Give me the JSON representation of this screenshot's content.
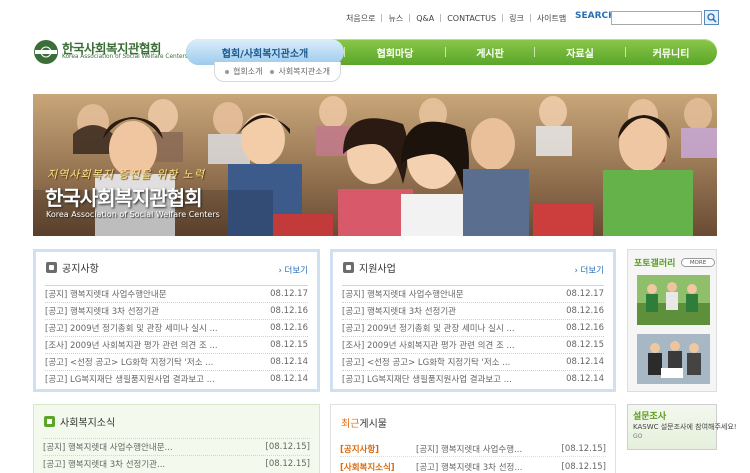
{
  "top_nav": {
    "items": [
      "처음으로",
      "뉴스",
      "Q&A",
      "CONTACTUS",
      "링크",
      "사이트맵"
    ],
    "search_label": "SEARCH",
    "search_value": ""
  },
  "logo": {
    "name_ko": "한국사회복지관협회",
    "name_en": "Korea Association of Social Welfare Centers"
  },
  "main_nav": {
    "tabs": [
      "협회/사회복지관소개",
      "협회마당",
      "게시판",
      "자료실",
      "커뮤니티"
    ],
    "active": "협회/사회복지관소개",
    "sub_items": [
      "협회소개",
      "사회복지관소개"
    ]
  },
  "hero": {
    "slogan": "지역사회복지 증진을 위한 노력",
    "title": "한국사회복지관협회",
    "subtitle": "Korea Association of Social Welfare Centers"
  },
  "notice": {
    "title": "공지사항",
    "more": "› 더보기",
    "rows": [
      {
        "title": "[공지] 행복지렛대 사업수행안내문",
        "date": "08.12.17"
      },
      {
        "title": "[공고] 행복지렛대 3차 선정기관",
        "date": "08.12.16"
      },
      {
        "title": "[공고] 2009년 정기총회 및 관장 세미나 실시 ...",
        "date": "08.12.16"
      },
      {
        "title": "[조사] 2009년 사회복지관 평가 관련 의견 조 ...",
        "date": "08.12.15"
      },
      {
        "title": "[공고] <선정 공고> LG화학 지정기탁 '저소 ...",
        "date": "08.12.14"
      },
      {
        "title": "[공고] LG복지재단 생필품지원사업 결과보고 ...",
        "date": "08.12.14"
      }
    ]
  },
  "support": {
    "title": "지원사업",
    "more": "› 더보기",
    "rows": [
      {
        "title": "[공지] 행복지렛대 사업수행안내문",
        "date": "08.12.17"
      },
      {
        "title": "[공고] 행복지렛대 3차 선정기관",
        "date": "08.12.16"
      },
      {
        "title": "[공고] 2009년 정기총회 및 관장 세미나 실시 ...",
        "date": "08.12.16"
      },
      {
        "title": "[조사] 2009년 사회복지관 평가 관련 의견 조 ...",
        "date": "08.12.15"
      },
      {
        "title": "[공고] <선정 공고> LG화학 지정기탁 '저소 ...",
        "date": "08.12.14"
      },
      {
        "title": "[공고] LG복지재단 생필품지원사업 결과보고 ...",
        "date": "08.12.14"
      }
    ]
  },
  "gallery": {
    "title": "포토갤러리",
    "more": "MORE"
  },
  "welfare_news": {
    "title": "사회복지소식",
    "rows": [
      {
        "title": "[공지] 행복지렛대 사업수행안내문...",
        "date": "[08.12.15]"
      },
      {
        "title": "[공고] 행복지렛대 3차 선정기관...",
        "date": "[08.12.15]"
      }
    ]
  },
  "recent": {
    "title_highlight": "최근",
    "title_rest": "게시물",
    "rows": [
      {
        "category": "[공지사항]",
        "title": "[공지] 행복지렛대 사업수행...",
        "date": "[08.12.15]"
      },
      {
        "category": "[사회복지소식]",
        "title": "[공고] 행복지렛대 3차 선정...",
        "date": "[08.12.15]"
      }
    ]
  },
  "survey": {
    "title": "설문조사",
    "text": "KASWC 설문조사에",
    "text2": "참여해주세요!",
    "go": "GO"
  },
  "colors": {
    "nav_green": "#5aa62a",
    "active_blue": "#9ccbee",
    "link_blue": "#2c70b5",
    "accent_orange": "#e26b14"
  }
}
